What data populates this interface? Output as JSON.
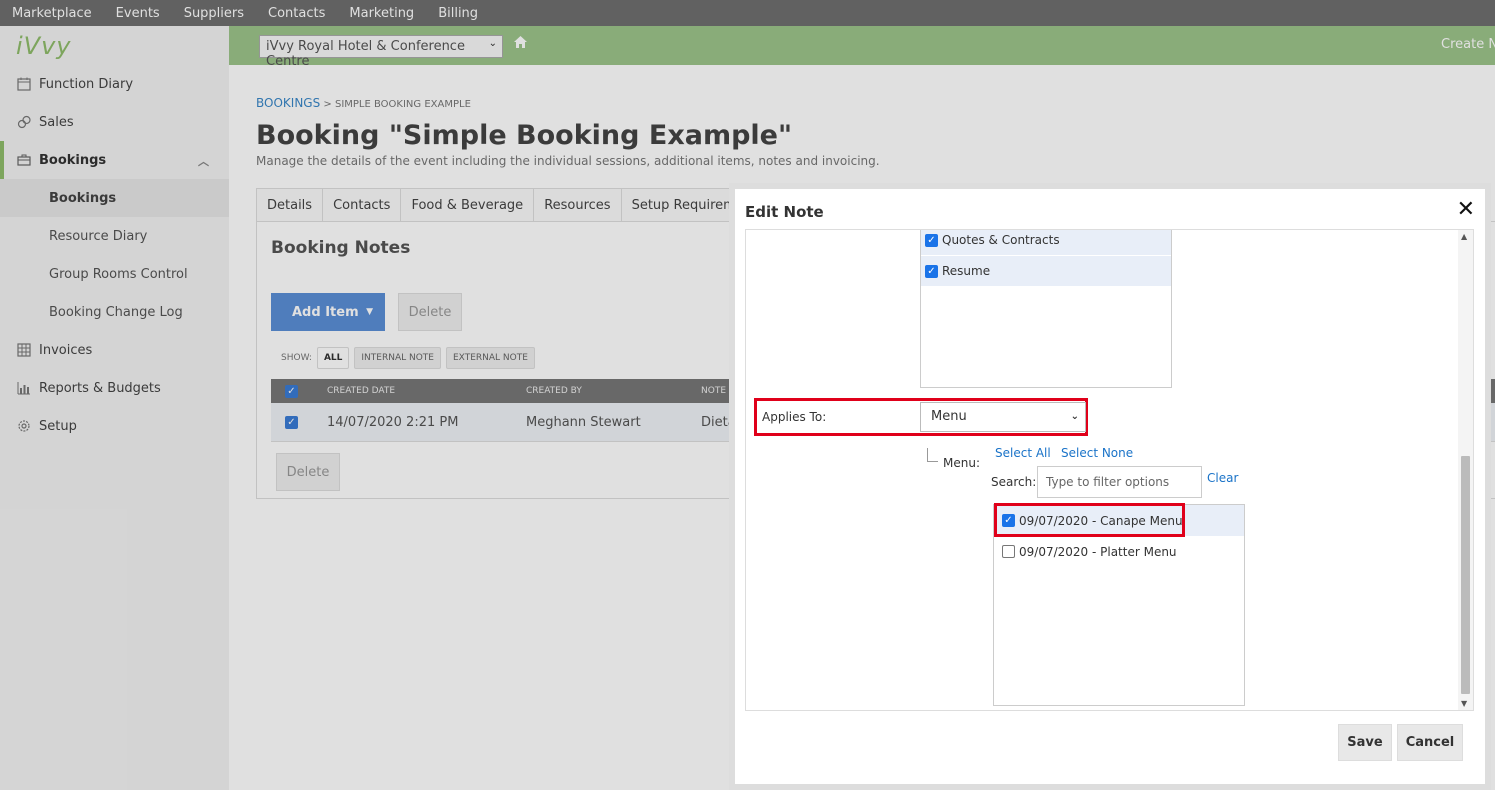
{
  "topnav": [
    "Marketplace",
    "Events",
    "Suppliers",
    "Contacts",
    "Marketing",
    "Billing"
  ],
  "logo": "iVvy",
  "sidebar": {
    "items": [
      {
        "label": "Function Diary",
        "icon": "calendar-icon"
      },
      {
        "label": "Sales",
        "icon": "sales-icon"
      },
      {
        "label": "Bookings",
        "icon": "briefcase-icon"
      },
      {
        "label": "Invoices",
        "icon": "table-icon"
      },
      {
        "label": "Reports & Budgets",
        "icon": "chart-icon"
      },
      {
        "label": "Setup",
        "icon": "gear-icon"
      }
    ],
    "sub_items": [
      "Bookings",
      "Resource Diary",
      "Group Rooms Control",
      "Booking Change Log"
    ]
  },
  "header": {
    "venue": "iVvy Royal Hotel & Conference Centre",
    "create_new": "Create New"
  },
  "main": {
    "breadcrumb_link": "BOOKINGS",
    "breadcrumb_sep": " > ",
    "breadcrumb_current": "SIMPLE BOOKING EXAMPLE",
    "title": "Booking \"Simple Booking Example\"",
    "subtitle": "Manage the details of the event including the individual sessions, additional items, notes and invoicing.",
    "tabs": [
      "Details",
      "Contacts",
      "Food & Beverage",
      "Resources",
      "Setup Requirements"
    ],
    "panel_title": "Booking Notes",
    "add_item": "Add Item",
    "delete": "Delete",
    "show_label": "SHOW:",
    "filters": [
      "ALL",
      "INTERNAL NOTE",
      "EXTERNAL NOTE"
    ],
    "columns": [
      "CREATED DATE",
      "CREATED BY",
      "NOTE"
    ],
    "row": {
      "date": "14/07/2020 2:21 PM",
      "by": "Meghann Stewart",
      "note": "Dietar"
    }
  },
  "modal": {
    "title": "Edit Note",
    "top_list": [
      {
        "label": "Quotes & Contracts",
        "checked": true
      },
      {
        "label": "Resume",
        "checked": true
      }
    ],
    "applies_to_label": "Applies To:",
    "applies_to_value": "Menu",
    "menu_label": "Menu:",
    "select_all": "Select All",
    "select_none": "Select None",
    "search_label": "Search:",
    "search_placeholder": "Type to filter options",
    "clear": "Clear",
    "menu_options": [
      {
        "label": "09/07/2020 - Canape Menu",
        "checked": true
      },
      {
        "label": "09/07/2020 - Platter Menu",
        "checked": false
      }
    ],
    "save": "Save",
    "cancel": "Cancel"
  },
  "colors": {
    "accent_green": "#9dc48a",
    "primary_blue": "#5b8fd6",
    "highlight_red": "#e0001a"
  }
}
